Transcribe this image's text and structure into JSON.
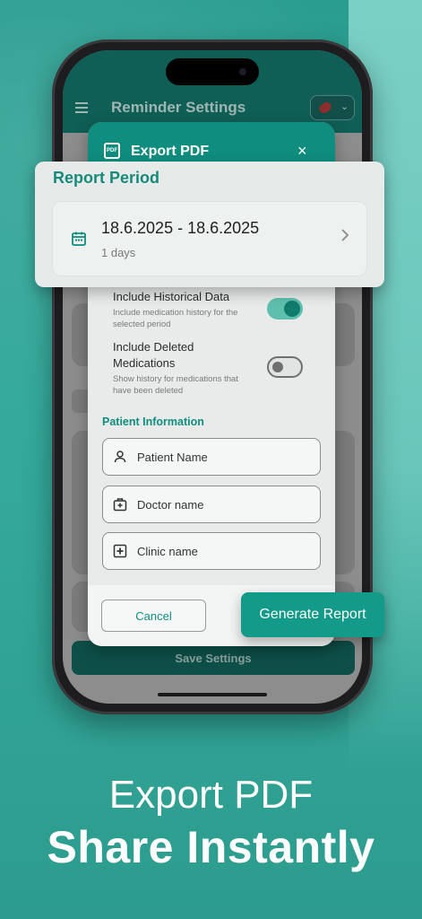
{
  "app": {
    "title": "Reminder Settings",
    "save_label": "Save Settings"
  },
  "dialog": {
    "title": "Export PDF",
    "pdf_badge": "PDF",
    "close": "×",
    "toggles": [
      {
        "title": "Include Historical Data",
        "description": "Include medication history for the selected period",
        "on": true
      },
      {
        "title": "Include Deleted Medications",
        "description": "Show history for medications that have been deleted",
        "on": false
      }
    ],
    "patient_section": "Patient Information",
    "fields": {
      "patient": "Patient Name",
      "doctor": "Doctor name",
      "clinic": "Clinic name"
    },
    "cancel_label": "Cancel",
    "generate_label": "Generate Report"
  },
  "report_period": {
    "title": "Report Period",
    "range": "18.6.2025 - 18.6.2025",
    "days": "1 days"
  },
  "promo": {
    "headline": "Export PDF",
    "tagline": "Share Instantly"
  },
  "colors": {
    "accent": "#0f8d7e",
    "background": "#2a9d90",
    "appbar": "#0f5f56"
  }
}
